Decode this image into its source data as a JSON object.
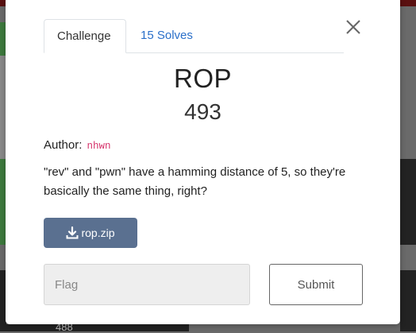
{
  "modal": {
    "tabs": [
      {
        "label": "Challenge"
      },
      {
        "label": "15 Solves"
      }
    ],
    "challenge": {
      "name": "ROP",
      "points": "493",
      "author_label": "Author:",
      "author_name": "nhwn",
      "description": "\"rev\" and \"pwn\" have a hamming distance of 5, so they're basically the same thing, right?",
      "file_label": "rop.zip"
    },
    "flag_placeholder": "Flag",
    "submit_label": "Submit"
  },
  "background": {
    "visible_number": "488"
  },
  "colors": {
    "link": "#2a6fc9",
    "download_button": "#5a7090",
    "author_code": "#d6336c"
  }
}
